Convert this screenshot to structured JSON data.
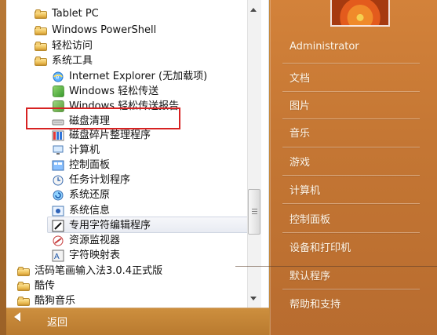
{
  "colors": {
    "panel_accent": "#c57734",
    "selection_outline": "#d72222",
    "highlight_row": "#e8ebf2"
  },
  "left_panel": {
    "items": [
      {
        "label": "Tablet PC",
        "icon": "folder-icon"
      },
      {
        "label": "Windows PowerShell",
        "icon": "folder-icon"
      },
      {
        "label": "轻松访问",
        "icon": "folder-icon"
      },
      {
        "label": "系统工具",
        "icon": "folder-icon"
      },
      {
        "label": "Internet Explorer (无加载项)",
        "icon": "internet-explorer-icon"
      },
      {
        "label": "Windows 轻松传送",
        "icon": "windows-easy-transfer-icon"
      },
      {
        "label": "Windows 轻松传送报告",
        "icon": "windows-easy-transfer-report-icon"
      },
      {
        "label": "磁盘清理",
        "icon": "disk-cleanup-icon"
      },
      {
        "label": "磁盘碎片整理程序",
        "icon": "disk-defragmenter-icon"
      },
      {
        "label": "计算机",
        "icon": "computer-icon"
      },
      {
        "label": "控制面板",
        "icon": "control-panel-icon"
      },
      {
        "label": "任务计划程序",
        "icon": "task-scheduler-icon"
      },
      {
        "label": "系统还原",
        "icon": "system-restore-icon"
      },
      {
        "label": "系统信息",
        "icon": "system-information-icon"
      },
      {
        "label": "专用字符编辑程序",
        "icon": "private-character-editor-icon"
      },
      {
        "label": "资源监视器",
        "icon": "resource-monitor-icon"
      },
      {
        "label": "字符映射表",
        "icon": "character-map-icon"
      },
      {
        "label": "活码笔画输入法3.0.4正式版",
        "icon": "folder-icon"
      },
      {
        "label": "酷传",
        "icon": "folder-icon"
      },
      {
        "label": "酷狗音乐",
        "icon": "folder-icon"
      }
    ],
    "back_label": "返回"
  },
  "right_panel": {
    "items": [
      {
        "label": "Administrator"
      },
      {
        "label": "文档"
      },
      {
        "label": "图片"
      },
      {
        "label": "音乐"
      },
      {
        "label": "游戏"
      },
      {
        "label": "计算机"
      },
      {
        "label": "控制面板"
      },
      {
        "label": "设备和打印机"
      },
      {
        "label": "默认程序"
      },
      {
        "label": "帮助和支持"
      }
    ]
  }
}
